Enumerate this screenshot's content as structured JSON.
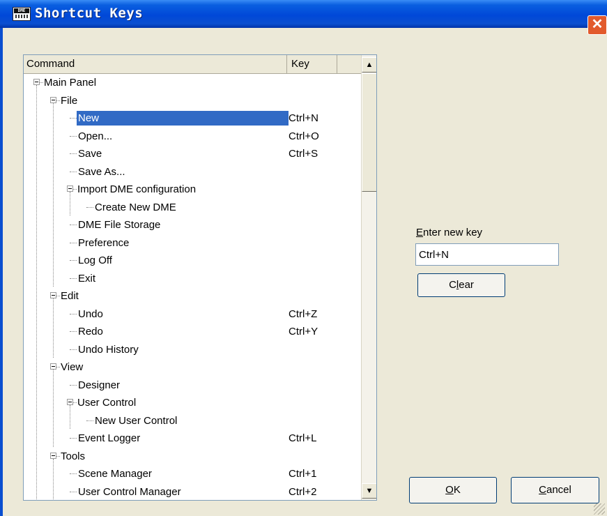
{
  "window": {
    "title": "Shortcut Keys",
    "icon_text": "DME",
    "icon_name": "dme-app-icon",
    "close_glyph": "✕"
  },
  "list": {
    "headers": {
      "command": "Command",
      "key": "Key"
    },
    "scroll_up_glyph": "▲",
    "scroll_down_glyph": "▼",
    "rows": [
      {
        "label": "Main Panel",
        "key": "",
        "level": 0,
        "expander": true
      },
      {
        "label": "File",
        "key": "",
        "level": 1,
        "expander": true
      },
      {
        "label": "New",
        "key": "Ctrl+N",
        "level": 2,
        "selected": true
      },
      {
        "label": "Open...",
        "key": "Ctrl+O",
        "level": 2
      },
      {
        "label": "Save",
        "key": "Ctrl+S",
        "level": 2
      },
      {
        "label": "Save As...",
        "key": "",
        "level": 2
      },
      {
        "label": "Import DME configuration",
        "key": "",
        "level": 2,
        "expander": true
      },
      {
        "label": "Create New DME",
        "key": "",
        "level": 3
      },
      {
        "label": "DME File Storage",
        "key": "",
        "level": 2
      },
      {
        "label": "Preference",
        "key": "",
        "level": 2
      },
      {
        "label": "Log Off",
        "key": "",
        "level": 2
      },
      {
        "label": "Exit",
        "key": "",
        "level": 2
      },
      {
        "label": "Edit",
        "key": "",
        "level": 1,
        "expander": true
      },
      {
        "label": "Undo",
        "key": "Ctrl+Z",
        "level": 2
      },
      {
        "label": "Redo",
        "key": "Ctrl+Y",
        "level": 2
      },
      {
        "label": "Undo History",
        "key": "",
        "level": 2
      },
      {
        "label": "View",
        "key": "",
        "level": 1,
        "expander": true
      },
      {
        "label": "Designer",
        "key": "",
        "level": 2
      },
      {
        "label": "User Control",
        "key": "",
        "level": 2,
        "expander": true
      },
      {
        "label": "New User Control",
        "key": "",
        "level": 3
      },
      {
        "label": "Event Logger",
        "key": "Ctrl+L",
        "level": 2
      },
      {
        "label": "Tools",
        "key": "",
        "level": 1,
        "expander": true
      },
      {
        "label": "Scene Manager",
        "key": "Ctrl+1",
        "level": 2
      },
      {
        "label": "User Control Manager",
        "key": "Ctrl+2",
        "level": 2
      }
    ]
  },
  "enter_key": {
    "label_accel": "E",
    "label_rest": "nter new key",
    "value": "Ctrl+N"
  },
  "buttons": {
    "clear": {
      "pre": "C",
      "accel": "l",
      "post": "ear"
    },
    "ok": {
      "pre": "",
      "accel": "O",
      "post": "K"
    },
    "cancel": {
      "pre": "",
      "accel": "C",
      "post": "ancel"
    }
  },
  "colors": {
    "titlebar": "#0a4fd0",
    "selection": "#316ac5",
    "face": "#ece9d8"
  }
}
